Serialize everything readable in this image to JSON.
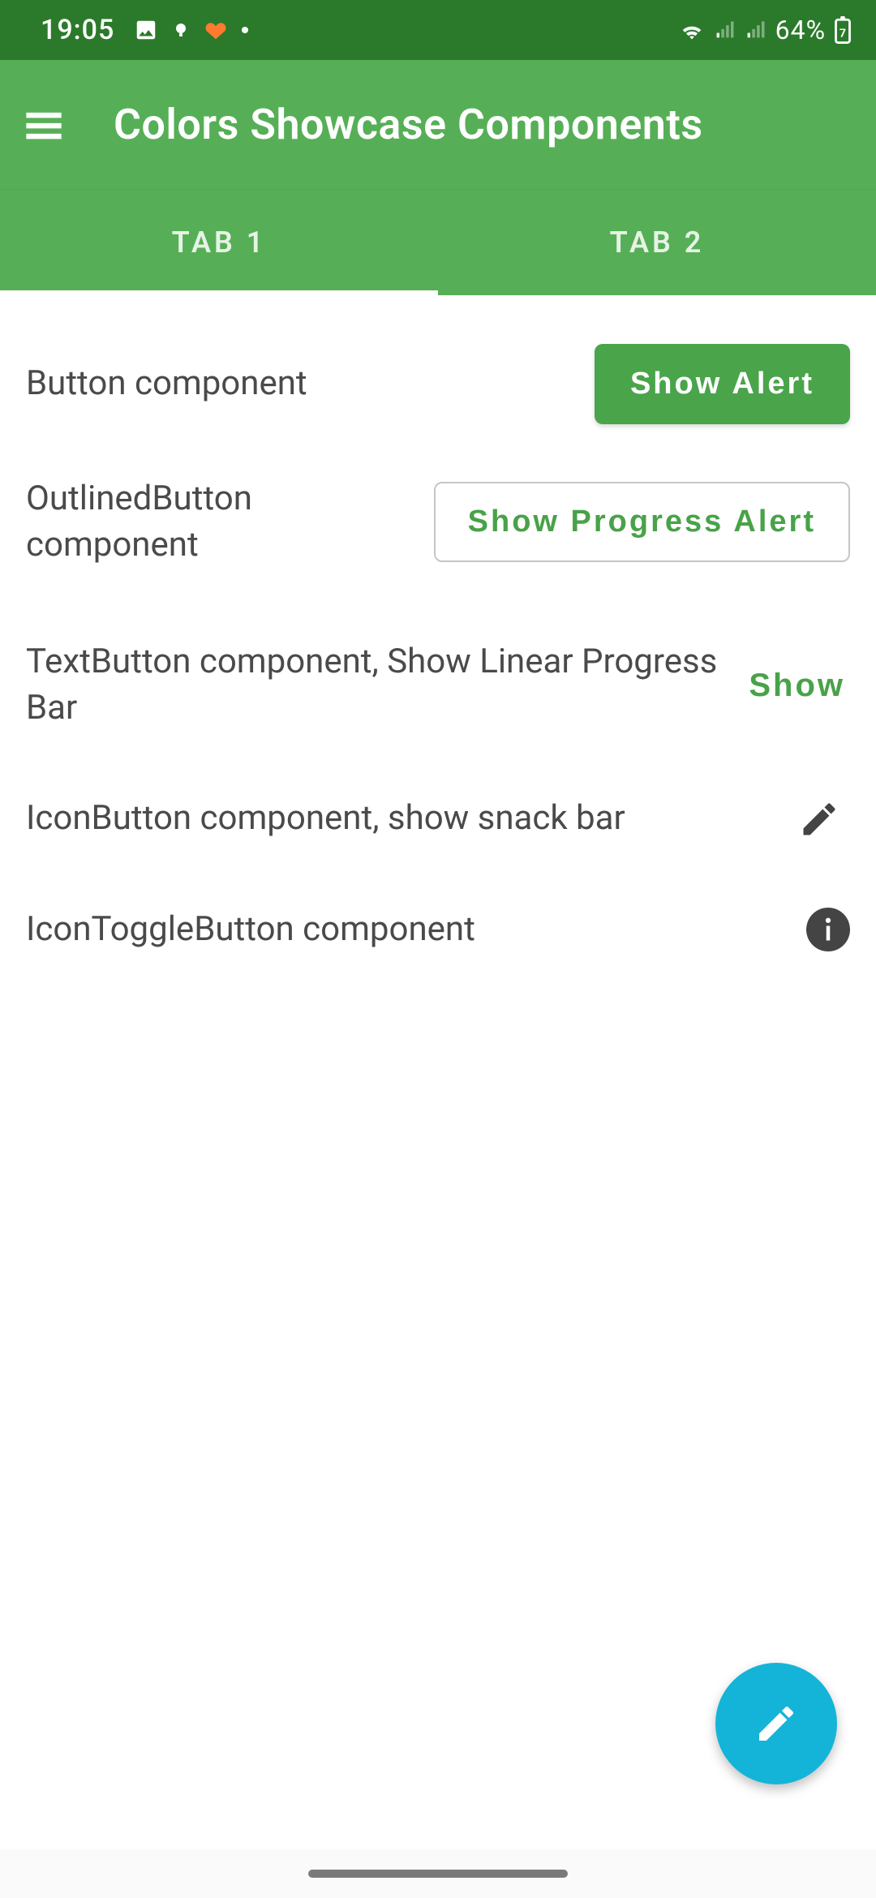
{
  "status": {
    "time": "19:05",
    "battery": "64%"
  },
  "appbar": {
    "title": "Colors Showcase Components"
  },
  "tabs": [
    {
      "label": "TAB 1",
      "active": true
    },
    {
      "label": "TAB 2",
      "active": false
    }
  ],
  "rows": {
    "button": {
      "label": "Button component",
      "action": "Show Alert"
    },
    "outlined": {
      "label": "OutlinedButton component",
      "action": "Show Progress Alert"
    },
    "textbtn": {
      "label": "TextButton component, Show Linear Progress Bar",
      "action": "Show"
    },
    "iconbtn": {
      "label": "IconButton component, show snack bar"
    },
    "icontoggle": {
      "label": "IconToggleButton component"
    }
  },
  "colors": {
    "status_bar": "#2b7a2b",
    "primary": "#56af56",
    "primary_variant": "#4aa44a",
    "accent_text": "#49a249",
    "fab": "#14b4d8",
    "text": "#4a4a4a"
  }
}
